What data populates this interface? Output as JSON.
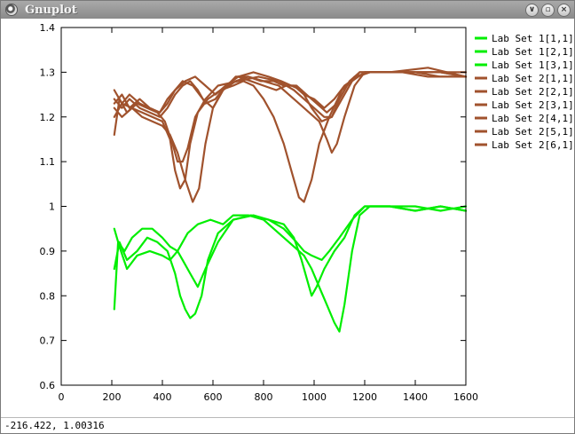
{
  "window": {
    "title": "Gnuplot",
    "buttons": {
      "menu": "∨",
      "minimize": "▫",
      "close": "×"
    }
  },
  "statusbar": {
    "coords": "-216.422,  1.00316"
  },
  "colors": {
    "set1": "#00ee00",
    "set2": "#a0522d",
    "axis": "#000000"
  },
  "chart_data": {
    "type": "line",
    "title": "",
    "xlabel": "",
    "ylabel": "",
    "xlim": [
      0,
      1600
    ],
    "ylim": [
      0.6,
      1.4
    ],
    "xticks": [
      0,
      200,
      400,
      600,
      800,
      1000,
      1200,
      1400,
      1600
    ],
    "yticks": [
      0.6,
      0.7,
      0.8,
      0.9,
      1,
      1.1,
      1.2,
      1.3,
      1.4
    ],
    "ytick_labels": [
      "0.6",
      "0.7",
      "0.8",
      "0.9",
      "1",
      "1.1",
      "1.2",
      "1.3",
      "1.4"
    ],
    "grid": false,
    "legend_position": "outside-top-right",
    "series": [
      {
        "name": "Lab Set 1[1,1]",
        "color": "#00ee00",
        "points": [
          [
            210,
            0.86
          ],
          [
            230,
            0.92
          ],
          [
            260,
            0.88
          ],
          [
            300,
            0.9
          ],
          [
            340,
            0.93
          ],
          [
            380,
            0.92
          ],
          [
            420,
            0.9
          ],
          [
            450,
            0.85
          ],
          [
            470,
            0.8
          ],
          [
            490,
            0.77
          ],
          [
            510,
            0.75
          ],
          [
            530,
            0.76
          ],
          [
            555,
            0.8
          ],
          [
            580,
            0.88
          ],
          [
            620,
            0.94
          ],
          [
            680,
            0.97
          ],
          [
            760,
            0.98
          ],
          [
            820,
            0.97
          ],
          [
            880,
            0.96
          ],
          [
            920,
            0.93
          ],
          [
            950,
            0.88
          ],
          [
            975,
            0.83
          ],
          [
            990,
            0.8
          ],
          [
            1010,
            0.82
          ],
          [
            1040,
            0.86
          ],
          [
            1080,
            0.9
          ],
          [
            1120,
            0.93
          ],
          [
            1160,
            0.98
          ],
          [
            1200,
            1.0
          ],
          [
            1300,
            1.0
          ],
          [
            1400,
            0.99
          ],
          [
            1500,
            1.0
          ],
          [
            1600,
            0.99
          ]
        ]
      },
      {
        "name": "Lab Set 1[2,1]",
        "color": "#00ee00",
        "points": [
          [
            210,
            0.77
          ],
          [
            225,
            0.92
          ],
          [
            250,
            0.9
          ],
          [
            280,
            0.93
          ],
          [
            320,
            0.95
          ],
          [
            360,
            0.95
          ],
          [
            400,
            0.93
          ],
          [
            430,
            0.91
          ],
          [
            460,
            0.9
          ],
          [
            480,
            0.88
          ],
          [
            510,
            0.85
          ],
          [
            540,
            0.82
          ],
          [
            570,
            0.86
          ],
          [
            620,
            0.92
          ],
          [
            680,
            0.97
          ],
          [
            750,
            0.98
          ],
          [
            820,
            0.97
          ],
          [
            880,
            0.95
          ],
          [
            930,
            0.92
          ],
          [
            960,
            0.9
          ],
          [
            990,
            0.89
          ],
          [
            1030,
            0.88
          ],
          [
            1060,
            0.9
          ],
          [
            1100,
            0.93
          ],
          [
            1150,
            0.97
          ],
          [
            1200,
            1.0
          ],
          [
            1300,
            1.0
          ],
          [
            1400,
            0.99
          ],
          [
            1500,
            1.0
          ],
          [
            1600,
            0.99
          ]
        ]
      },
      {
        "name": "Lab Set 1[3,1]",
        "color": "#00ee00",
        "points": [
          [
            210,
            0.95
          ],
          [
            230,
            0.91
          ],
          [
            260,
            0.86
          ],
          [
            300,
            0.89
          ],
          [
            350,
            0.9
          ],
          [
            400,
            0.89
          ],
          [
            430,
            0.88
          ],
          [
            460,
            0.9
          ],
          [
            500,
            0.94
          ],
          [
            540,
            0.96
          ],
          [
            590,
            0.97
          ],
          [
            640,
            0.96
          ],
          [
            680,
            0.98
          ],
          [
            740,
            0.98
          ],
          [
            800,
            0.97
          ],
          [
            860,
            0.94
          ],
          [
            920,
            0.91
          ],
          [
            960,
            0.89
          ],
          [
            990,
            0.86
          ],
          [
            1020,
            0.82
          ],
          [
            1050,
            0.78
          ],
          [
            1080,
            0.74
          ],
          [
            1100,
            0.72
          ],
          [
            1120,
            0.78
          ],
          [
            1150,
            0.9
          ],
          [
            1180,
            0.98
          ],
          [
            1220,
            1.0
          ],
          [
            1300,
            1.0
          ],
          [
            1400,
            1.0
          ],
          [
            1500,
            0.99
          ],
          [
            1600,
            1.0
          ]
        ]
      },
      {
        "name": "Lab Set 2[1,1]",
        "color": "#a0522d",
        "points": [
          [
            210,
            1.16
          ],
          [
            230,
            1.24
          ],
          [
            260,
            1.21
          ],
          [
            300,
            1.23
          ],
          [
            340,
            1.22
          ],
          [
            380,
            1.21
          ],
          [
            410,
            1.19
          ],
          [
            440,
            1.14
          ],
          [
            460,
            1.1
          ],
          [
            480,
            1.1
          ],
          [
            500,
            1.13
          ],
          [
            530,
            1.2
          ],
          [
            570,
            1.24
          ],
          [
            620,
            1.27
          ],
          [
            700,
            1.28
          ],
          [
            780,
            1.29
          ],
          [
            860,
            1.28
          ],
          [
            920,
            1.26
          ],
          [
            960,
            1.24
          ],
          [
            1000,
            1.22
          ],
          [
            1040,
            1.2
          ],
          [
            1070,
            1.2
          ],
          [
            1100,
            1.24
          ],
          [
            1140,
            1.28
          ],
          [
            1180,
            1.3
          ],
          [
            1300,
            1.3
          ],
          [
            1400,
            1.3
          ],
          [
            1500,
            1.29
          ],
          [
            1600,
            1.29
          ]
        ]
      },
      {
        "name": "Lab Set 2[2,1]",
        "color": "#a0522d",
        "points": [
          [
            210,
            1.2
          ],
          [
            240,
            1.23
          ],
          [
            280,
            1.22
          ],
          [
            320,
            1.21
          ],
          [
            360,
            1.2
          ],
          [
            400,
            1.19
          ],
          [
            430,
            1.15
          ],
          [
            450,
            1.08
          ],
          [
            470,
            1.04
          ],
          [
            490,
            1.06
          ],
          [
            510,
            1.14
          ],
          [
            540,
            1.21
          ],
          [
            580,
            1.24
          ],
          [
            630,
            1.26
          ],
          [
            680,
            1.27
          ],
          [
            720,
            1.28
          ],
          [
            760,
            1.27
          ],
          [
            800,
            1.24
          ],
          [
            840,
            1.2
          ],
          [
            880,
            1.14
          ],
          [
            910,
            1.08
          ],
          [
            940,
            1.02
          ],
          [
            960,
            1.01
          ],
          [
            990,
            1.06
          ],
          [
            1020,
            1.14
          ],
          [
            1060,
            1.2
          ],
          [
            1110,
            1.26
          ],
          [
            1160,
            1.29
          ],
          [
            1220,
            1.3
          ],
          [
            1350,
            1.3
          ],
          [
            1450,
            1.29
          ],
          [
            1600,
            1.29
          ]
        ]
      },
      {
        "name": "Lab Set 2[3,1]",
        "color": "#a0522d",
        "points": [
          [
            210,
            1.22
          ],
          [
            240,
            1.2
          ],
          [
            280,
            1.22
          ],
          [
            320,
            1.2
          ],
          [
            360,
            1.19
          ],
          [
            400,
            1.18
          ],
          [
            430,
            1.16
          ],
          [
            460,
            1.12
          ],
          [
            490,
            1.06
          ],
          [
            520,
            1.01
          ],
          [
            545,
            1.04
          ],
          [
            570,
            1.14
          ],
          [
            600,
            1.22
          ],
          [
            640,
            1.26
          ],
          [
            690,
            1.28
          ],
          [
            740,
            1.29
          ],
          [
            800,
            1.28
          ],
          [
            860,
            1.27
          ],
          [
            900,
            1.25
          ],
          [
            940,
            1.23
          ],
          [
            980,
            1.21
          ],
          [
            1020,
            1.19
          ],
          [
            1050,
            1.15
          ],
          [
            1070,
            1.12
          ],
          [
            1090,
            1.14
          ],
          [
            1120,
            1.2
          ],
          [
            1160,
            1.27
          ],
          [
            1200,
            1.3
          ],
          [
            1350,
            1.3
          ],
          [
            1500,
            1.3
          ],
          [
            1600,
            1.29
          ]
        ]
      },
      {
        "name": "Lab Set 2[4,1]",
        "color": "#a0522d",
        "points": [
          [
            210,
            1.24
          ],
          [
            240,
            1.22
          ],
          [
            270,
            1.24
          ],
          [
            310,
            1.22
          ],
          [
            350,
            1.21
          ],
          [
            390,
            1.2
          ],
          [
            420,
            1.22
          ],
          [
            450,
            1.25
          ],
          [
            480,
            1.27
          ],
          [
            510,
            1.28
          ],
          [
            540,
            1.26
          ],
          [
            570,
            1.23
          ],
          [
            610,
            1.24
          ],
          [
            650,
            1.27
          ],
          [
            700,
            1.29
          ],
          [
            760,
            1.3
          ],
          [
            820,
            1.29
          ],
          [
            870,
            1.28
          ],
          [
            910,
            1.27
          ],
          [
            950,
            1.26
          ],
          [
            990,
            1.22
          ],
          [
            1030,
            1.19
          ],
          [
            1070,
            1.2
          ],
          [
            1110,
            1.24
          ],
          [
            1150,
            1.28
          ],
          [
            1200,
            1.3
          ],
          [
            1350,
            1.3
          ],
          [
            1500,
            1.3
          ],
          [
            1600,
            1.29
          ]
        ]
      },
      {
        "name": "Lab Set 2[5,1]",
        "color": "#a0522d",
        "points": [
          [
            210,
            1.26
          ],
          [
            240,
            1.23
          ],
          [
            270,
            1.25
          ],
          [
            310,
            1.23
          ],
          [
            350,
            1.22
          ],
          [
            390,
            1.21
          ],
          [
            420,
            1.23
          ],
          [
            450,
            1.26
          ],
          [
            480,
            1.28
          ],
          [
            520,
            1.27
          ],
          [
            560,
            1.24
          ],
          [
            600,
            1.22
          ],
          [
            640,
            1.26
          ],
          [
            690,
            1.29
          ],
          [
            740,
            1.29
          ],
          [
            790,
            1.28
          ],
          [
            840,
            1.28
          ],
          [
            880,
            1.27
          ],
          [
            920,
            1.27
          ],
          [
            960,
            1.25
          ],
          [
            1000,
            1.24
          ],
          [
            1040,
            1.22
          ],
          [
            1080,
            1.24
          ],
          [
            1120,
            1.27
          ],
          [
            1170,
            1.29
          ],
          [
            1220,
            1.3
          ],
          [
            1350,
            1.3
          ],
          [
            1500,
            1.3
          ],
          [
            1600,
            1.3
          ]
        ]
      },
      {
        "name": "Lab Set 2[6,1]",
        "color": "#a0522d",
        "points": [
          [
            210,
            1.23
          ],
          [
            240,
            1.25
          ],
          [
            270,
            1.22
          ],
          [
            310,
            1.24
          ],
          [
            350,
            1.22
          ],
          [
            390,
            1.21
          ],
          [
            420,
            1.24
          ],
          [
            450,
            1.26
          ],
          [
            490,
            1.28
          ],
          [
            530,
            1.29
          ],
          [
            570,
            1.27
          ],
          [
            610,
            1.25
          ],
          [
            650,
            1.27
          ],
          [
            700,
            1.29
          ],
          [
            750,
            1.28
          ],
          [
            800,
            1.27
          ],
          [
            850,
            1.26
          ],
          [
            890,
            1.27
          ],
          [
            930,
            1.27
          ],
          [
            970,
            1.25
          ],
          [
            1010,
            1.23
          ],
          [
            1050,
            1.21
          ],
          [
            1090,
            1.23
          ],
          [
            1130,
            1.27
          ],
          [
            1180,
            1.3
          ],
          [
            1300,
            1.3
          ],
          [
            1450,
            1.31
          ],
          [
            1600,
            1.29
          ]
        ]
      }
    ]
  }
}
